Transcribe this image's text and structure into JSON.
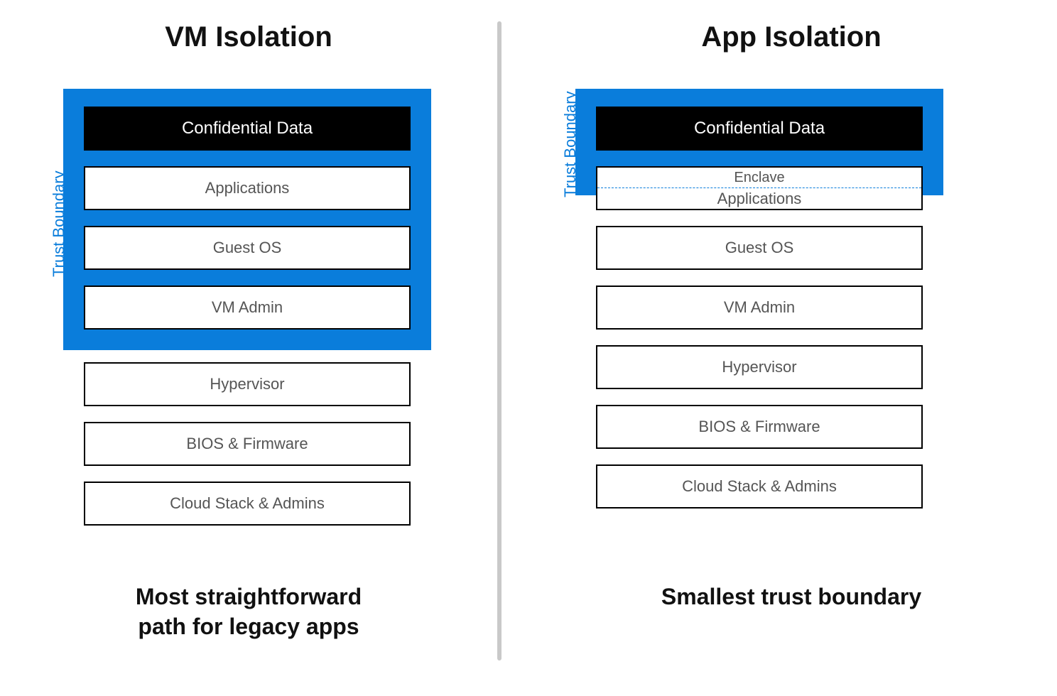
{
  "left": {
    "title": "VM Isolation",
    "trust_label": "Trust Boundary",
    "layers": {
      "data": "Confidential Data",
      "apps": "Applications",
      "guest": "Guest OS",
      "vmadmin": "VM Admin",
      "hyper": "Hypervisor",
      "bios": "BIOS & Firmware",
      "cloud": "Cloud Stack & Admins"
    },
    "caption_line1": "Most straightforward",
    "caption_line2": "path for legacy apps"
  },
  "right": {
    "title": "App Isolation",
    "trust_label": "Trust Boundary",
    "layers": {
      "data": "Confidential Data",
      "enclave": "Enclave",
      "apps": "Applications",
      "guest": "Guest OS",
      "vmadmin": "VM Admin",
      "hyper": "Hypervisor",
      "bios": "BIOS & Firmware",
      "cloud": "Cloud Stack & Admins"
    },
    "caption": "Smallest trust boundary"
  }
}
